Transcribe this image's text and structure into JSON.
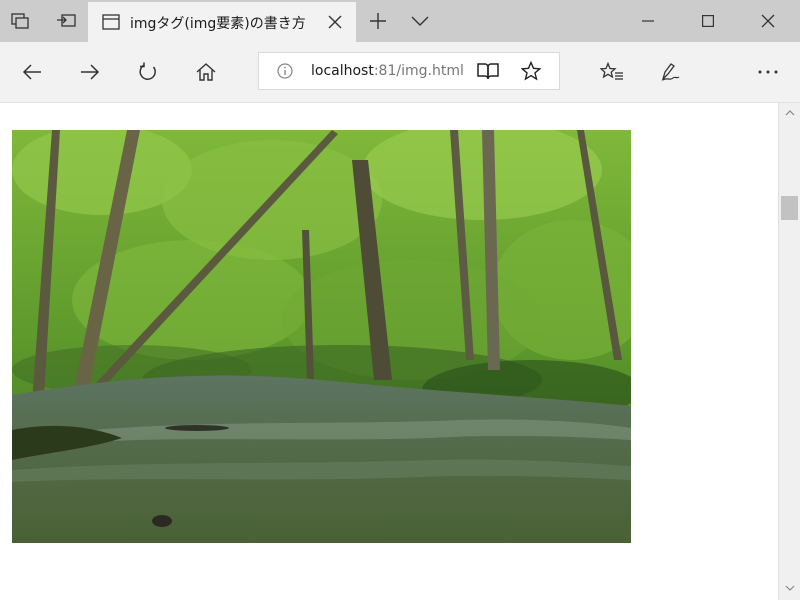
{
  "browser": {
    "tab": {
      "title": "imgタグ(img要素)の書き方"
    },
    "address": {
      "host": "localhost",
      "rest": ":81/img.html"
    }
  },
  "page": {
    "image": {
      "alt": "Forest stream photo"
    }
  },
  "colors": {
    "titlebar": "#cccccc",
    "tab_active": "#f2f2f2",
    "navbar": "#f2f2f2",
    "icon": "#333333"
  },
  "icons": {
    "tab_actions": "tab-actions-icon",
    "set_aside": "set-aside-tabs-icon",
    "page": "page-icon",
    "close_tab": "close-icon",
    "new_tab": "plus-icon",
    "tab_preview": "chevron-down-icon",
    "minimize": "minimize-icon",
    "maximize": "maximize-icon",
    "close_window": "close-icon",
    "back": "back-arrow-icon",
    "forward": "forward-arrow-icon",
    "refresh": "refresh-icon",
    "home": "home-icon",
    "info": "info-icon",
    "reading_view": "book-icon",
    "favorite": "star-icon",
    "favorites_hub": "favorites-icon",
    "web_note": "pen-icon",
    "more": "more-icon"
  }
}
